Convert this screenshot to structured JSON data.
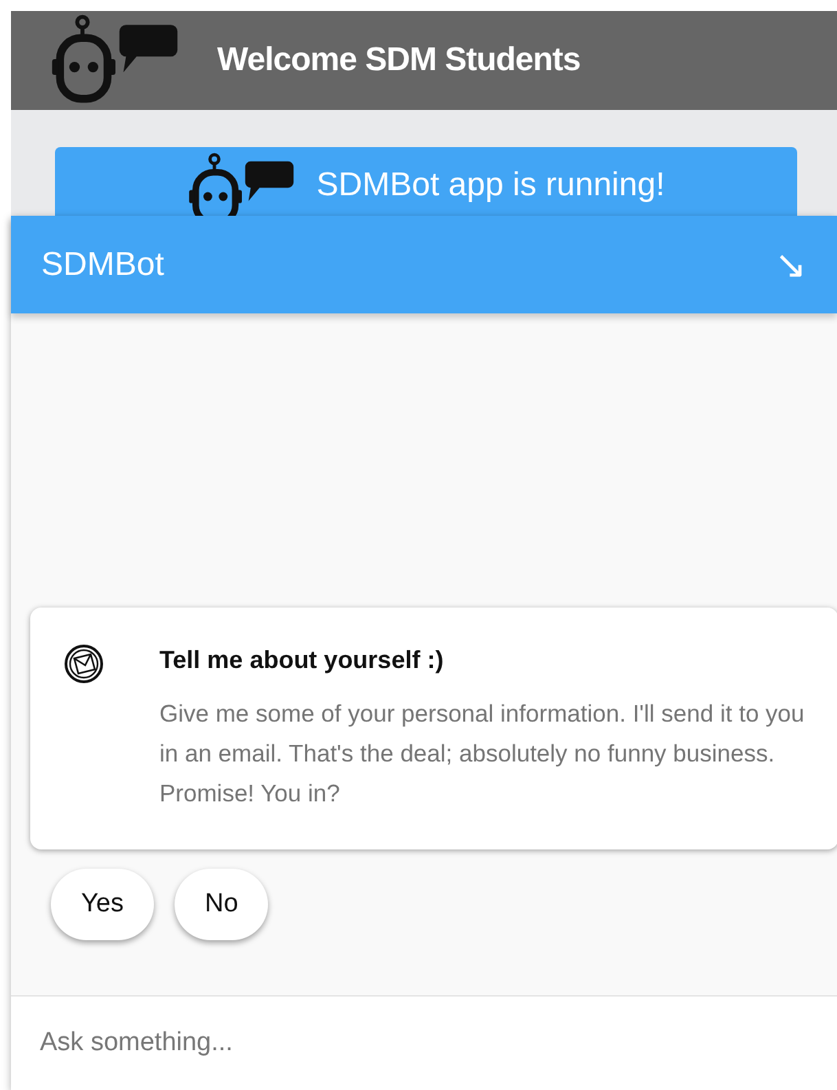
{
  "header": {
    "title": "Welcome SDM Students"
  },
  "banner": {
    "text": "SDMBot app is running!"
  },
  "chat": {
    "title": "SDMBot",
    "minimize_icon": "↘",
    "card": {
      "title": "Tell me about yourself :)",
      "body": "Give me some of your personal information. I'll send it to you in an email. That's the deal; absolutely no funny business. Promise! You in?"
    },
    "replies": [
      "Yes",
      "No"
    ],
    "input": {
      "placeholder": "Ask something..."
    }
  }
}
